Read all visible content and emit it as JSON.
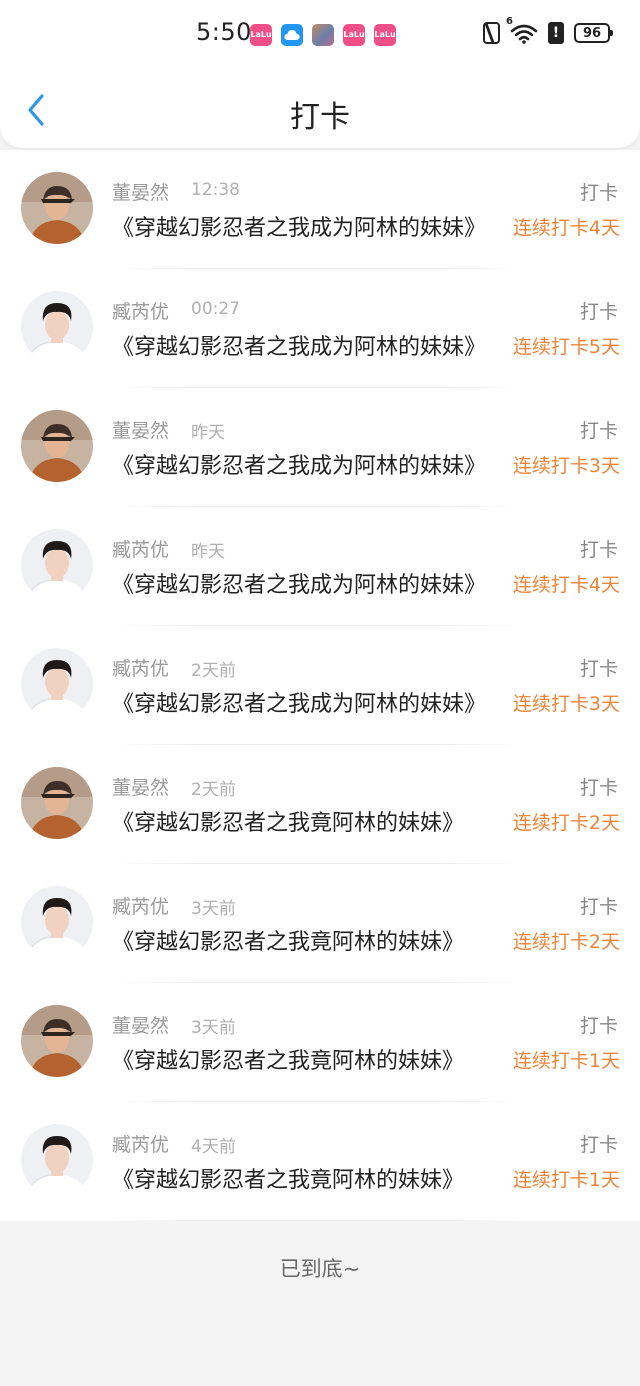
{
  "status_bar": {
    "time": "5:50",
    "notifications": [
      {
        "icon": "lalu-app-icon",
        "text": "LaLu",
        "color": "#ef4e86"
      },
      {
        "icon": "cloud-app-icon",
        "text": "",
        "color": "#2196f3"
      },
      {
        "icon": "game-app-icon",
        "text": "",
        "color": "#c98a63"
      },
      {
        "icon": "lalu-app-icon",
        "text": "LaLu",
        "color": "#ef4e86"
      },
      {
        "icon": "lalu-app-icon",
        "text": "LaLu",
        "color": "#ef4e86"
      }
    ],
    "signal_label": "6",
    "alert_label": "!",
    "battery": "96"
  },
  "header": {
    "title": "打卡",
    "back_icon": "chevron-left-icon",
    "accent_color": "#2f98e6"
  },
  "records": [
    {
      "user": "董晏然",
      "avatar": "user-a",
      "time": "12:38",
      "tag": "打卡",
      "book": "《穿越幻影忍者之我成为阿林的妹妹》",
      "streak": "连续打卡4天"
    },
    {
      "user": "臧芮优",
      "avatar": "user-b",
      "time": "00:27",
      "tag": "打卡",
      "book": "《穿越幻影忍者之我成为阿林的妹妹》",
      "streak": "连续打卡5天"
    },
    {
      "user": "董晏然",
      "avatar": "user-a",
      "time": "昨天",
      "tag": "打卡",
      "book": "《穿越幻影忍者之我成为阿林的妹妹》",
      "streak": "连续打卡3天"
    },
    {
      "user": "臧芮优",
      "avatar": "user-b",
      "time": "昨天",
      "tag": "打卡",
      "book": "《穿越幻影忍者之我成为阿林的妹妹》",
      "streak": "连续打卡4天"
    },
    {
      "user": "臧芮优",
      "avatar": "user-b",
      "time": "2天前",
      "tag": "打卡",
      "book": "《穿越幻影忍者之我成为阿林的妹妹》",
      "streak": "连续打卡3天"
    },
    {
      "user": "董晏然",
      "avatar": "user-a",
      "time": "2天前",
      "tag": "打卡",
      "book": "《穿越幻影忍者之我竟阿林的妹妹》",
      "streak": "连续打卡2天"
    },
    {
      "user": "臧芮优",
      "avatar": "user-b",
      "time": "3天前",
      "tag": "打卡",
      "book": "《穿越幻影忍者之我竟阿林的妹妹》",
      "streak": "连续打卡2天"
    },
    {
      "user": "董晏然",
      "avatar": "user-a",
      "time": "3天前",
      "tag": "打卡",
      "book": "《穿越幻影忍者之我竟阿林的妹妹》",
      "streak": "连续打卡1天"
    },
    {
      "user": "臧芮优",
      "avatar": "user-b",
      "time": "4天前",
      "tag": "打卡",
      "book": "《穿越幻影忍者之我竟阿林的妹妹》",
      "streak": "连续打卡1天"
    }
  ],
  "footer": {
    "end_text": "已到底~"
  },
  "colors": {
    "streak": "#f0853a",
    "muted": "#9a9a9a",
    "background": "#f5f4f4"
  }
}
